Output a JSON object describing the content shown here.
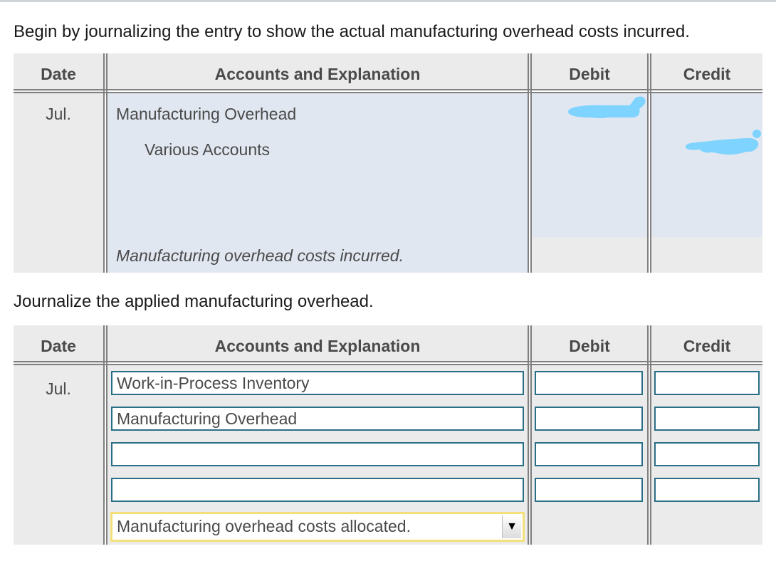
{
  "instructions": {
    "part1": "Begin by journalizing the entry to show the actual manufacturing overhead costs incurred.",
    "part2": "Journalize the applied manufacturing overhead."
  },
  "columns": {
    "date": "Date",
    "accounts": "Accounts and Explanation",
    "debit": "Debit",
    "credit": "Credit"
  },
  "entry1": {
    "date": "Jul.",
    "debit_account": "Manufacturing Overhead",
    "credit_account": "Various Accounts",
    "explanation": "Manufacturing overhead costs incurred.",
    "debit_amount": "",
    "credit_amount": "",
    "amounts_redacted": true,
    "redaction_color": "#7fd3ff"
  },
  "entry2": {
    "date": "Jul.",
    "rows": [
      {
        "account": "Work-in-Process Inventory",
        "debit": "",
        "credit": ""
      },
      {
        "account": "Manufacturing Overhead",
        "debit": "",
        "credit": ""
      },
      {
        "account": "",
        "debit": "",
        "credit": ""
      },
      {
        "account": "",
        "debit": "",
        "credit": ""
      }
    ],
    "explanation_selected": "Manufacturing overhead costs allocated.",
    "dropdown_icon": "triangle-down"
  },
  "colors": {
    "input_border": "#2a6f86",
    "select_focus_border": "#f3e07a",
    "given_row_bg": "#e1e7f1",
    "header_bg": "#ebebeb"
  }
}
